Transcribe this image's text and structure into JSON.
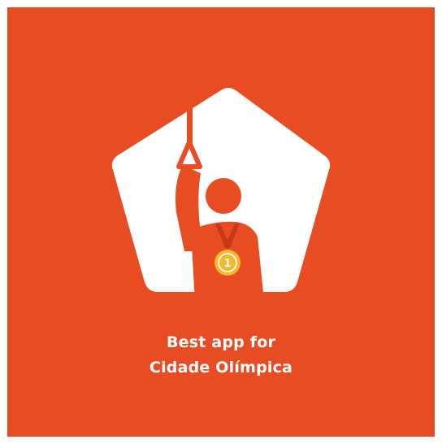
{
  "colors": {
    "background": "#e84c23",
    "shape": "#ffffff",
    "medal_gold": "#f3b82c",
    "medal_ribbon": "#c8391a"
  },
  "icons": {
    "logo": "pentagon-commuter-medal-icon",
    "medal": "gold-medal-icon"
  },
  "medal": {
    "number": "1"
  },
  "tagline": {
    "line1": "Best app for",
    "line2": "Cidade Olímpica"
  }
}
